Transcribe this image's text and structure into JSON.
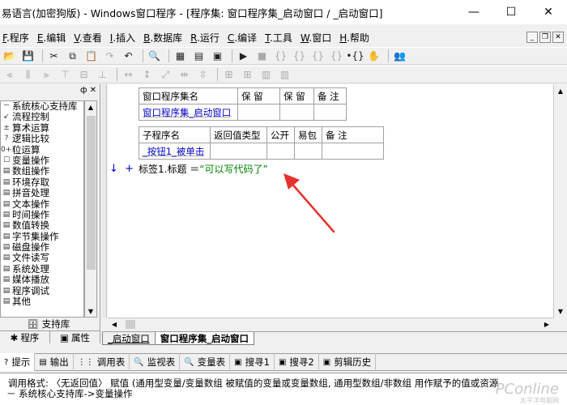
{
  "titlebar": {
    "title": "易语言(加密狗版) - Windows窗口程序 - [程序集: 窗口程序集_启动窗口 / _启动窗口]",
    "min": "—",
    "max": "☐",
    "close": "✕"
  },
  "menu": {
    "items": [
      {
        "key": "F",
        "label": ".程序"
      },
      {
        "key": "E",
        "label": ".编辑"
      },
      {
        "key": "V",
        "label": ".查看"
      },
      {
        "key": "I",
        "label": ".插入"
      },
      {
        "key": "B",
        "label": ".数据库"
      },
      {
        "key": "R",
        "label": ".运行"
      },
      {
        "key": "C",
        "label": ".编译"
      },
      {
        "key": "T",
        "label": ".工具"
      },
      {
        "key": "W",
        "label": ".窗口"
      },
      {
        "key": "H",
        "label": ".帮助"
      }
    ],
    "mdi_min": "_",
    "mdi_restore": "❐",
    "mdi_close": "✕"
  },
  "left_panel": {
    "pin": "ф",
    "close": "✕",
    "tree": [
      {
        "icon": "－",
        "label": "系统核心支持库"
      },
      {
        "icon": "↙",
        "label": "流程控制"
      },
      {
        "icon": "±",
        "label": "算术运算"
      },
      {
        "icon": "?",
        "label": "逻辑比较"
      },
      {
        "icon": "0+1",
        "label": "位运算"
      },
      {
        "icon": "☐",
        "label": "变量操作"
      },
      {
        "icon": "▤",
        "label": "数组操作"
      },
      {
        "icon": "▤",
        "label": "环境存取"
      },
      {
        "icon": "▤",
        "label": "拼音处理"
      },
      {
        "icon": "▤",
        "label": "文本操作"
      },
      {
        "icon": "▤",
        "label": "时间操作"
      },
      {
        "icon": "▤",
        "label": "数值转换"
      },
      {
        "icon": "▤",
        "label": "字节集操作"
      },
      {
        "icon": "▤",
        "label": "磁盘操作"
      },
      {
        "icon": "▤",
        "label": "文件读写"
      },
      {
        "icon": "▤",
        "label": "系统处理"
      },
      {
        "icon": "▤",
        "label": "媒体播放"
      },
      {
        "icon": "▤",
        "label": "程序调试"
      },
      {
        "icon": "▤",
        "label": "其他"
      }
    ],
    "library_label": "支持库",
    "tab_program": "程序",
    "tab_property": "属性"
  },
  "code": {
    "table1_headers": [
      "窗口程序集名",
      "保 留",
      "保 留",
      "备 注"
    ],
    "table1_row": [
      "窗口程序集_启动窗口",
      "",
      "",
      ""
    ],
    "table2_headers": [
      "子程序名",
      "返回值类型",
      "公开",
      "易包",
      "备 注"
    ],
    "table2_row": [
      "_按钮1_被单击",
      "",
      "",
      "",
      ""
    ],
    "line_ops": [
      "↓",
      "+"
    ],
    "line_code": "标签1.标题 ＝ ",
    "line_string": "“可以写代码了”"
  },
  "code_tabs": [
    {
      "label": "_启动窗口",
      "active": false
    },
    {
      "label": "窗口程序集_启动窗口",
      "active": true
    }
  ],
  "bottom_tabs": [
    {
      "icon": "?",
      "label": "提示"
    },
    {
      "icon": "▤",
      "label": "输出"
    },
    {
      "icon": "⋮⋮",
      "label": "调用表"
    },
    {
      "icon": "🔍",
      "label": "监视表"
    },
    {
      "icon": "🔍",
      "label": "变量表"
    },
    {
      "icon": "▣",
      "label": "搜寻1"
    },
    {
      "icon": "▣",
      "label": "搜寻2"
    },
    {
      "icon": "▣",
      "label": "剪辑历史"
    }
  ],
  "help": {
    "line1": "调用格式: 〈无返回值〉 赋值 (通用型变量/变量数组 被赋值的变量或变量数组, 通用型数组/非数组 用作赋予的值或资源",
    "line2": "－ 系统核心支持库->变量操作"
  },
  "watermark": {
    "brand": "PConline",
    "sub": "太平洋电脑网"
  },
  "colors": {
    "keyword_blue": "#0000c8",
    "string_green": "#008000",
    "arrow_red": "#e5322d"
  }
}
